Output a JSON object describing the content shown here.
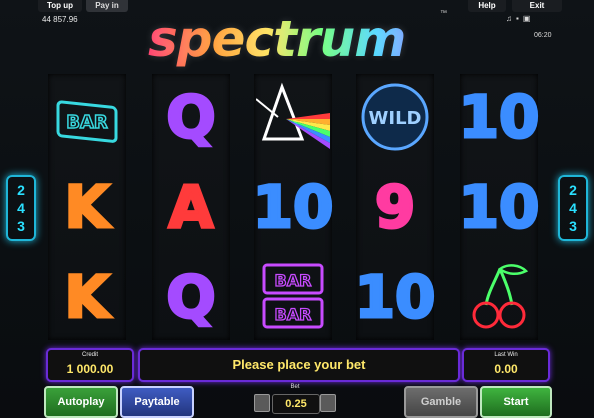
{
  "topbar": {
    "top_up": "Top up",
    "pay_in": "Pay in",
    "help": "Help",
    "exit": "Exit",
    "balance": "44 857.96",
    "time": "06:20",
    "system_icons": [
      "music-note-icon",
      "speaker-icon",
      "fullscreen-icon"
    ]
  },
  "logo": {
    "text": "spectrum",
    "trademark": "™"
  },
  "side_labels": {
    "left": [
      "2",
      "4",
      "3"
    ],
    "right": [
      "2",
      "4",
      "3"
    ]
  },
  "reels": [
    [
      {
        "text": "BAR",
        "color": "#38d9e0"
      },
      {
        "text": "K",
        "color": "#ff8a24"
      },
      {
        "text": "K",
        "color": "#ff8a24"
      }
    ],
    [
      {
        "text": "Q",
        "color": "#a44bff"
      },
      {
        "text": "A",
        "color": "#ff3b3b"
      },
      {
        "text": "Q",
        "color": "#a44bff"
      }
    ],
    [
      {
        "text": "prism",
        "color": "#ffffff"
      },
      {
        "text": "10",
        "color": "#3b8dff"
      },
      {
        "text": "BAR BAR",
        "color": "#c84bff"
      }
    ],
    [
      {
        "text": "WILD",
        "color": "#5aa7ff"
      },
      {
        "text": "9",
        "color": "#ff3ba1"
      },
      {
        "text": "10",
        "color": "#3b8dff"
      }
    ],
    [
      {
        "text": "10",
        "color": "#3b8dff"
      },
      {
        "text": "10",
        "color": "#3b8dff"
      },
      {
        "text": "cherry",
        "color": "#ff2a3a"
      }
    ]
  ],
  "credit": {
    "label": "Credit",
    "value": "1 000.00"
  },
  "message": "Please place your bet",
  "last_win": {
    "label": "Last Win",
    "value": "0.00"
  },
  "buttons": {
    "autoplay": "Autoplay",
    "paytable": "Paytable",
    "gamble": "Gamble",
    "start": "Start"
  },
  "bet": {
    "label": "Bet",
    "value": "0.25"
  }
}
